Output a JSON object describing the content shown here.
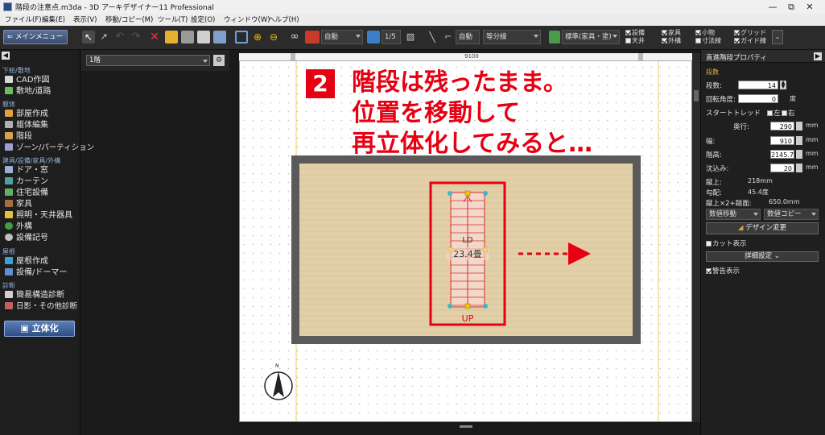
{
  "window": {
    "title": "階段の注意点.m3da - 3D アーキデザイナー11 Professional",
    "controls": [
      "—",
      "⧉",
      "✕"
    ]
  },
  "menu": [
    "ファイル(F)",
    "編集(E)",
    "表示(V)",
    "移動/コピー(M)",
    "ツール(T)",
    "設定(O)",
    "ウィンドウ(W)",
    "ヘルプ(H)"
  ],
  "toolbar": {
    "main_menu_button": "メインメニュー",
    "auto_select_1": "自動",
    "scale_select": "1/5",
    "auto_select_2": "自動",
    "division_select": "等分線",
    "standard_select": "標準(家具・塗)",
    "checks": [
      {
        "label": "設備",
        "checked": true
      },
      {
        "label": "天井",
        "checked": false
      },
      {
        "label": "家具",
        "checked": true
      },
      {
        "label": "外構",
        "checked": true
      },
      {
        "label": "小物",
        "checked": true
      },
      {
        "label": "寸法線",
        "checked": false
      },
      {
        "label": "グリッド",
        "checked": true
      },
      {
        "label": "ガイド線",
        "checked": true
      }
    ]
  },
  "left_panel": {
    "sections": [
      {
        "title": "下絵/敷地",
        "items": [
          "CAD作図",
          "敷地/道路"
        ]
      },
      {
        "title": "躯体",
        "items": [
          "部屋作成",
          "躯体編集",
          "階段",
          "ゾーン/パーティション"
        ]
      },
      {
        "title": "建具/設備/家具/外構",
        "items": [
          "ドア・窓",
          "カーテン",
          "住宅設備",
          "家具",
          "照明・天井器具",
          "外構",
          "設備記号"
        ]
      },
      {
        "title": "屋根",
        "items": [
          "屋根作成",
          "設備/ドーマー"
        ]
      },
      {
        "title": "診断",
        "items": [
          "簡易構造診断",
          "日影・その他診断"
        ]
      }
    ],
    "render_button": "立体化"
  },
  "floor_selector": {
    "value": "1階"
  },
  "canvas": {
    "ruler_label": "9100",
    "room_name": "LD",
    "room_area": "23.4畳",
    "stair_label": "UP",
    "compass_label": "N"
  },
  "overlay": {
    "step_number": "2",
    "caption_lines": [
      "階段は残ったまま。",
      "位置を移動して",
      "再立体化してみると…"
    ]
  },
  "properties": {
    "title": "直進階段プロパティ",
    "section": "段数",
    "steps_label": "段数:",
    "steps_value": "14",
    "rotation_label": "回転角度:",
    "rotation_value": "0",
    "rotation_unit": "度",
    "start_tread_label": "スタートトレッド",
    "left_label": "左",
    "right_label": "右",
    "depth_label": "奥行:",
    "depth_value": "290",
    "width_label": "幅:",
    "width_value": "910",
    "ceiling_label": "階高:",
    "ceiling_value": "2145.71",
    "sink_label": "沈込み:",
    "sink_value": "20",
    "unit_mm": "mm",
    "rise_label": "蹴上:",
    "rise_value": "218mm",
    "slope_label": "勾配:",
    "slope_value": "45.4度",
    "formula_label": "蹴上×2+踏面:",
    "formula_value": "650.0mm",
    "move_select": "数値移動",
    "copy_select": "数値コピー",
    "design_change_button": "デザイン変更",
    "cut_display_label": "カット表示",
    "cut_display_checked": false,
    "detail_settings_button": "詳細設定",
    "warning_display_label": "警告表示",
    "warning_display_checked": true
  },
  "colors": {
    "accent_red": "#e60012",
    "room_floor": "#e2cfa8",
    "stair_red": "#d83030",
    "handle_gold": "#f2c200",
    "handle_teal": "#3cb8c8"
  }
}
